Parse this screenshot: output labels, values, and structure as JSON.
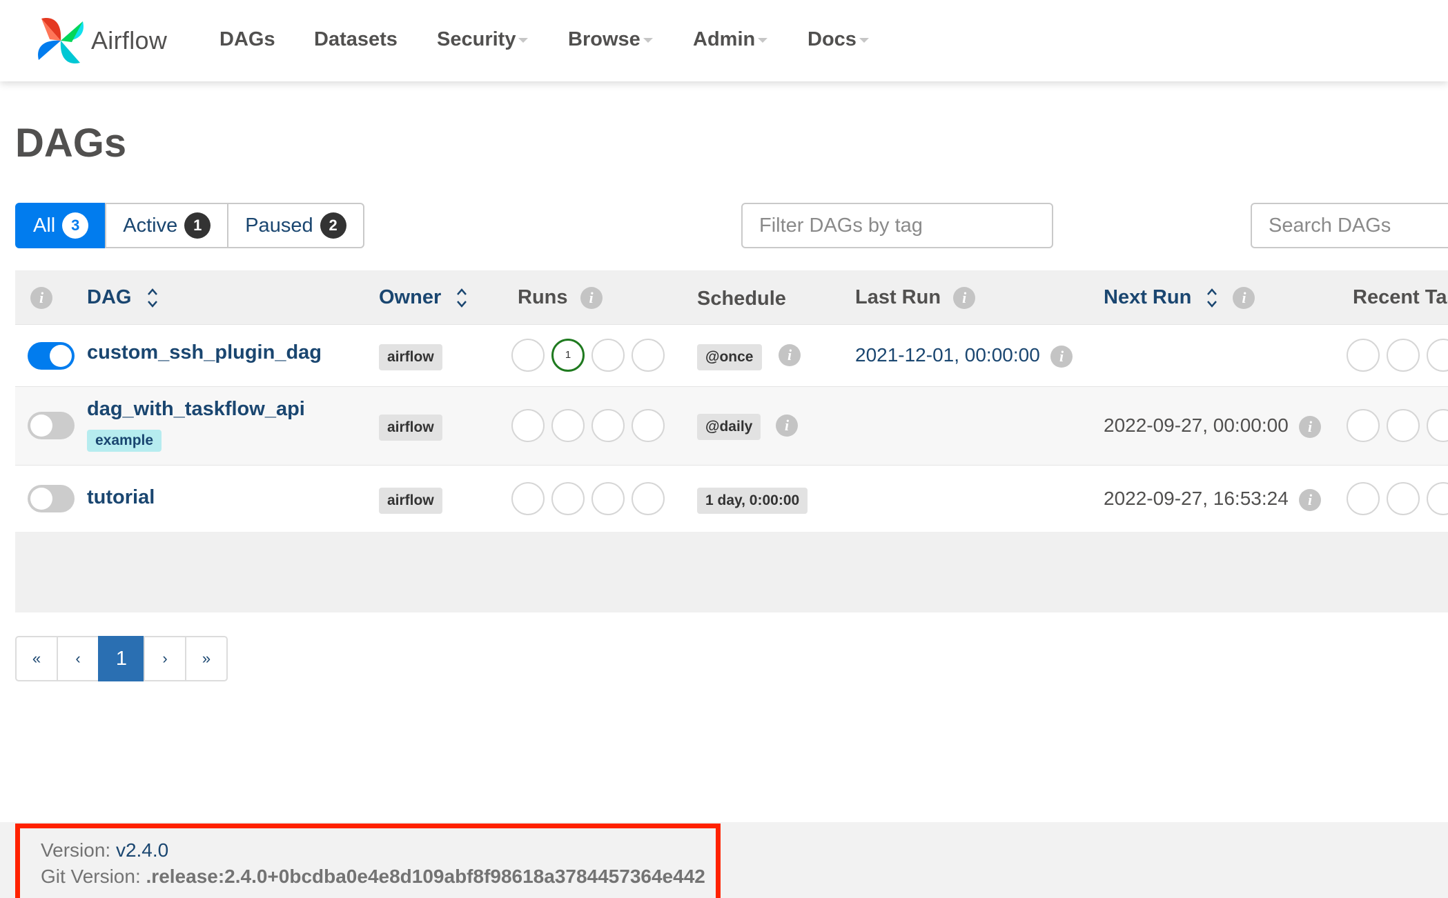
{
  "brand": {
    "name": "Airflow"
  },
  "nav": {
    "items": [
      {
        "label": "DAGs",
        "dropdown": false
      },
      {
        "label": "Datasets",
        "dropdown": false
      },
      {
        "label": "Security",
        "dropdown": true
      },
      {
        "label": "Browse",
        "dropdown": true
      },
      {
        "label": "Admin",
        "dropdown": true
      },
      {
        "label": "Docs",
        "dropdown": true
      }
    ]
  },
  "page": {
    "title": "DAGs"
  },
  "filters": {
    "all": {
      "label": "All",
      "count": "3",
      "active": true
    },
    "active": {
      "label": "Active",
      "count": "1"
    },
    "paused": {
      "label": "Paused",
      "count": "2"
    },
    "tag_placeholder": "Filter DAGs by tag",
    "search_placeholder": "Search DAGs"
  },
  "table": {
    "headers": {
      "info": "i",
      "dag": "DAG",
      "owner": "Owner",
      "runs": "Runs",
      "schedule": "Schedule",
      "last_run": "Last Run",
      "next_run": "Next Run",
      "recent_tasks": "Recent Tasks"
    },
    "rows": [
      {
        "paused": false,
        "dag_id": "custom_ssh_plugin_dag",
        "tags": [],
        "owner": "airflow",
        "runs": [
          "",
          "1",
          "",
          ""
        ],
        "schedule": "@once",
        "last_run": "2021-12-01, 00:00:00",
        "next_run": ""
      },
      {
        "paused": true,
        "dag_id": "dag_with_taskflow_api",
        "tags": [
          "example"
        ],
        "owner": "airflow",
        "runs": [
          "",
          "",
          "",
          ""
        ],
        "schedule": "@daily",
        "last_run": "",
        "next_run": "2022-09-27, 00:00:00"
      },
      {
        "paused": true,
        "dag_id": "tutorial",
        "tags": [],
        "owner": "airflow",
        "runs": [
          "",
          "",
          "",
          ""
        ],
        "schedule": "1 day, 0:00:00",
        "last_run": "",
        "next_run": "2022-09-27, 16:53:24"
      }
    ]
  },
  "pagination": {
    "first": "«",
    "prev": "‹",
    "current": "1",
    "next": "›",
    "last": "»"
  },
  "footer": {
    "version_label": "Version:",
    "version": "v2.4.0",
    "git_label": "Git Version:",
    "git_version": ".release:2.4.0+0bcdba0e4e8d109abf8f98618a3784457364e442"
  },
  "colors": {
    "primary": "#017cee",
    "link": "#1a4670",
    "success": "#1f7a1f",
    "highlight_box": "#ff2200"
  }
}
